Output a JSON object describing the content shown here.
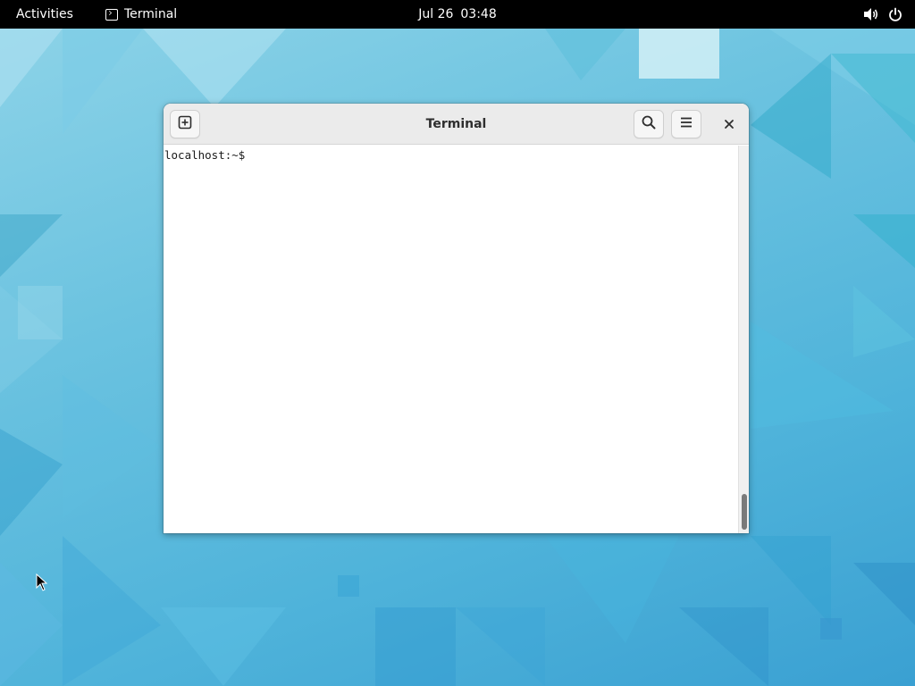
{
  "topbar": {
    "activities": "Activities",
    "app_name": "Terminal",
    "app_icon": "terminal-icon",
    "date": "Jul 26",
    "time": "03:48",
    "volume_icon": "volume-icon",
    "power_icon": "power-icon"
  },
  "window": {
    "title": "Terminal",
    "new_tab_icon": "new-tab-icon",
    "search_icon": "search-icon",
    "menu_icon": "hamburger-menu-icon",
    "close_icon": "close-icon",
    "prompt": "localhost:~$"
  },
  "colors": {
    "topbar_bg": "#000000",
    "headerbar_bg": "#ebebeb",
    "terminal_bg": "#ffffff",
    "wallpaper_accent": "#4fb3da"
  }
}
